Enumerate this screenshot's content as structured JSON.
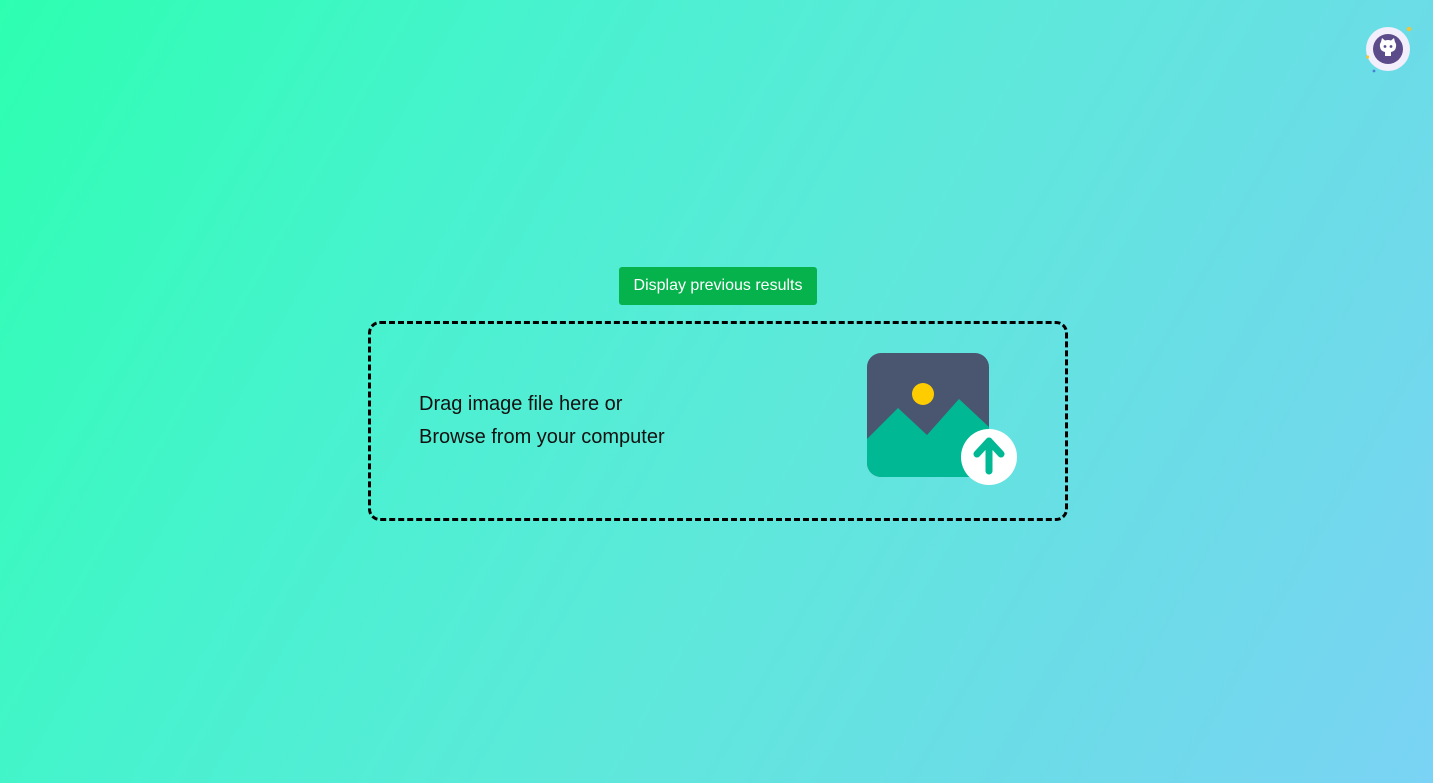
{
  "header": {
    "github_link_icon": "github-octocat-icon"
  },
  "toolbar": {
    "previous_results_label": "Display previous results"
  },
  "dropzone": {
    "line1": "Drag image file here or",
    "line2": "Browse from your computer",
    "illustration_icon": "image-upload-icon"
  },
  "colors": {
    "button_bg": "#06b24c",
    "gradient_start": "#2dffb0",
    "gradient_end": "#7ad3f4",
    "image_frame": "#4a5670",
    "mountains": "#00b894",
    "sun": "#ffcc00"
  }
}
